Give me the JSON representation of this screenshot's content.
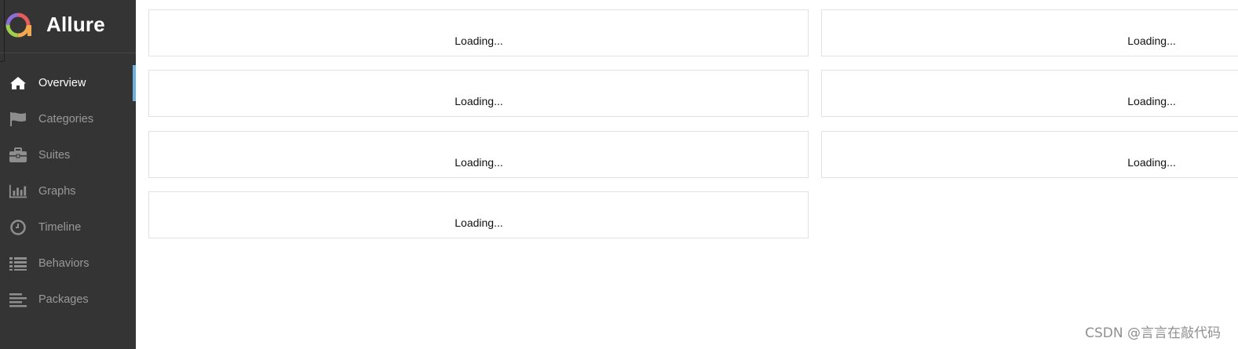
{
  "app": {
    "title": "Allure"
  },
  "sidebar": {
    "items": [
      {
        "label": "Overview",
        "icon": "home-icon",
        "active": true
      },
      {
        "label": "Categories",
        "icon": "flag-icon"
      },
      {
        "label": "Suites",
        "icon": "briefcase-icon"
      },
      {
        "label": "Graphs",
        "icon": "bar-chart-icon"
      },
      {
        "label": "Timeline",
        "icon": "clock-icon"
      },
      {
        "label": "Behaviors",
        "icon": "list-icon"
      },
      {
        "label": "Packages",
        "icon": "align-left-icon"
      }
    ]
  },
  "main": {
    "widgets": [
      {
        "loading_text": "Loading..."
      },
      {
        "loading_text": "Loading..."
      },
      {
        "loading_text": "Loading..."
      },
      {
        "loading_text": "Loading..."
      },
      {
        "loading_text": "Loading..."
      },
      {
        "loading_text": "Loading..."
      },
      {
        "loading_text": "Loading..."
      }
    ]
  },
  "watermark": "CSDN @言言在敲代码",
  "colors": {
    "sidebar_bg": "#343434",
    "active_indicator": "#6ab0de",
    "nav_text": "#999999",
    "nav_text_active": "#ffffff"
  }
}
